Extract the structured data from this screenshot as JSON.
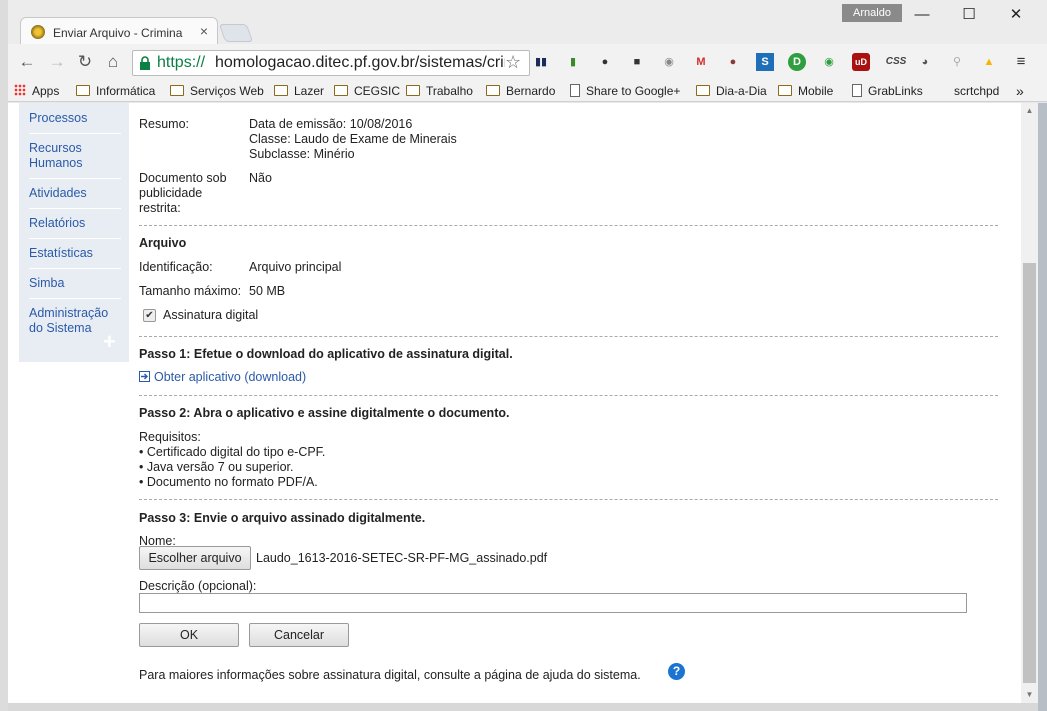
{
  "browser": {
    "tab_title": "Enviar Arquivo - Criminalística",
    "tab_close": "×",
    "user": "Arnaldo",
    "window_controls": [
      "—",
      "☐",
      "✕"
    ],
    "url_scheme": "https://",
    "url_host": "homologacao.ditec.pf.gov.br/sistemas/criminalistica",
    "nav_icons": [
      "back-arrow-icon",
      "forward-arrow-icon",
      "reload-icon",
      "home-icon"
    ],
    "extensions": [
      "folder-ext-icon",
      "evernote-ext-icon",
      "proxy-ext-icon",
      "puzzle-ext-icon",
      "g-ext-icon",
      "gmail-icon",
      "ball-ext-icon",
      "s-ext-icon",
      "d-ext-icon",
      "chat-ext-icon",
      "ublock-icon",
      "css-ext-icon",
      "eye-ext-icon",
      "search-ext-icon",
      "drive-ext-icon",
      "menu-icon"
    ],
    "css_ext_label": "CSS",
    "ublock_label": "uD",
    "bookmarks": {
      "apps": "Apps",
      "items": [
        "Informática",
        "Serviços Web",
        "Lazer",
        "CEGSIC",
        "Trabalho",
        "Bernardo",
        "Share to Google+",
        "Dia-a-Dia",
        "Mobile",
        "GrabLinks",
        "scrtchpd"
      ],
      "overflow": "»"
    }
  },
  "sidebar": {
    "items": [
      "Processos",
      "Recursos Humanos",
      "Atividades",
      "Relatórios",
      "Estatísticas",
      "Simba",
      "Administração do Sistema"
    ],
    "plus": "+"
  },
  "document": {
    "resumo_label": "Resumo:",
    "resumo_lines": [
      "Data de emissão: 10/08/2016",
      "Classe: Laudo de Exame de Minerais",
      "Subclasse: Minério"
    ],
    "restrita_label": "Documento sob publicidade restrita:",
    "restrita_value": "Não"
  },
  "arquivo": {
    "heading": "Arquivo",
    "identificacao_label": "Identificação:",
    "identificacao_value": "Arquivo principal",
    "tamanho_label": "Tamanho máximo:",
    "tamanho_value": "50 MB",
    "assinatura_label": "Assinatura digital",
    "assinatura_checked": "✔"
  },
  "passo1": {
    "heading": "Passo 1: Efetue o download do aplicativo de assinatura digital.",
    "link": "Obter aplicativo (download)"
  },
  "passo2": {
    "heading": "Passo 2: Abra o aplicativo e assine digitalmente o documento.",
    "requisitos": "Requisitos:",
    "items": [
      "• Certificado digital do tipo e-CPF.",
      "• Java versão 7 ou superior.",
      "• Documento no formato PDF/A."
    ]
  },
  "passo3": {
    "heading": "Passo 3: Envie o arquivo assinado digitalmente.",
    "nome_label": "Nome:",
    "choose_button": "Escolher arquivo",
    "file_name": "Laudo_1613-2016-SETEC-SR-PF-MG_assinado.pdf",
    "descricao_label": "Descrição (opcional):",
    "descricao_value": ""
  },
  "actions": {
    "ok": "OK",
    "cancel": "Cancelar"
  },
  "footer": {
    "help_text": "Para maiores informações sobre assinatura digital, consulte a página de ajuda do sistema.",
    "help_icon": "?"
  },
  "scrollbar": {
    "up": "▲",
    "down": "▼"
  }
}
